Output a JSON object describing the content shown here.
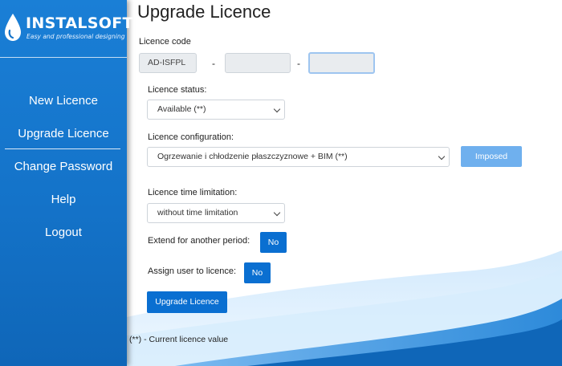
{
  "brand": {
    "name": "INSTALSOFT",
    "tagline": "Easy and professional designing"
  },
  "nav": {
    "items": [
      {
        "label": "New Licence"
      },
      {
        "label": "Upgrade Licence",
        "active": true
      },
      {
        "label": "Change Password"
      },
      {
        "label": "Help"
      },
      {
        "label": "Logout"
      }
    ]
  },
  "page": {
    "title": "Upgrade Licence"
  },
  "licence_code": {
    "label": "Licence code",
    "part1": "AD-ISFPL",
    "separator": "-",
    "part2": "",
    "part3": ""
  },
  "licence_status": {
    "label": "Licence status:",
    "selected": "Available (**)"
  },
  "licence_configuration": {
    "label": "Licence configuration:",
    "selected": "Ogrzewanie i chłodzenie płaszczyznowe + BIM (**)",
    "imposed_button": "Imposed"
  },
  "time_limitation": {
    "label": "Licence time limitation:",
    "selected": "without time limitation"
  },
  "extend": {
    "label": "Extend for another period:",
    "toggle": "No"
  },
  "assign_user": {
    "label": "Assign user to licence:",
    "toggle": "No"
  },
  "submit": {
    "label": "Upgrade Licence"
  },
  "footnote": "(**) - Current licence value",
  "colors": {
    "sidebar": "#1473c9",
    "primary_button": "#0a6fd1",
    "imposed_button": "#6fb0ee",
    "wave": "#1a7fd6"
  }
}
